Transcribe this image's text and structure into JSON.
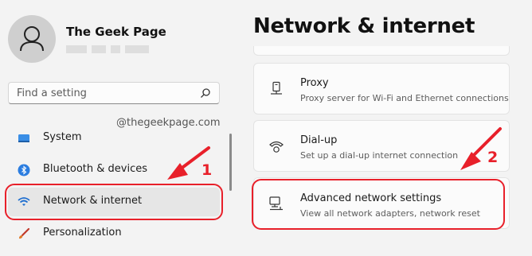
{
  "user": {
    "name": "The Geek Page"
  },
  "search": {
    "placeholder": "Find a setting"
  },
  "watermark": "@thegeekpage.com",
  "sidebar": {
    "items": [
      {
        "label": "System",
        "icon": "system-icon"
      },
      {
        "label": "Bluetooth & devices",
        "icon": "bluetooth-icon"
      },
      {
        "label": "Network & internet",
        "icon": "wifi-icon",
        "selected": true
      },
      {
        "label": "Personalization",
        "icon": "brush-icon"
      }
    ]
  },
  "main": {
    "title": "Network & internet",
    "cards": [
      {
        "title": "Proxy",
        "subtitle": "Proxy server for Wi-Fi and Ethernet connections",
        "icon": "proxy-icon"
      },
      {
        "title": "Dial-up",
        "subtitle": "Set up a dial-up internet connection",
        "icon": "dialup-icon"
      },
      {
        "title": "Advanced network settings",
        "subtitle": "View all network adapters, network reset",
        "icon": "advanced-network-icon"
      }
    ]
  },
  "annotations": {
    "step1": "1",
    "step2": "2",
    "color": "#e8202a"
  },
  "colors": {
    "accent": "#0067c0",
    "highlight": "#e8202a",
    "background": "#f3f3f3",
    "card": "#fbfbfb"
  }
}
